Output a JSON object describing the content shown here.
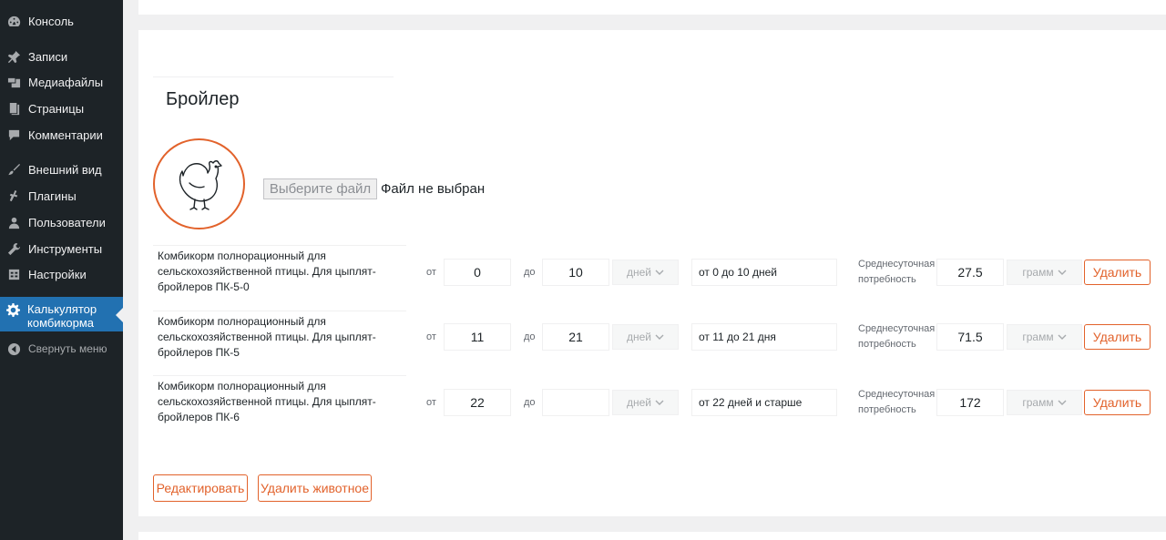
{
  "sidebar": {
    "items": [
      {
        "label": "Консоль",
        "icon": "dashboard-icon"
      },
      {
        "label": "Записи",
        "icon": "pin-icon"
      },
      {
        "label": "Медиафайлы",
        "icon": "media-icon"
      },
      {
        "label": "Страницы",
        "icon": "page-icon"
      },
      {
        "label": "Комментарии",
        "icon": "comment-icon"
      },
      {
        "label": "Внешний вид",
        "icon": "brush-icon"
      },
      {
        "label": "Плагины",
        "icon": "plugin-icon"
      },
      {
        "label": "Пользователи",
        "icon": "user-icon"
      },
      {
        "label": "Инструменты",
        "icon": "wrench-icon"
      },
      {
        "label": "Настройки",
        "icon": "settings-icon"
      }
    ],
    "active": {
      "label": "Калькулятор комбикорма",
      "icon": "gear-icon"
    },
    "collapse": {
      "label": "Свернуть меню",
      "icon": "collapse-icon"
    }
  },
  "animal": {
    "title": "Бройлер",
    "image_icon": "chicken-icon",
    "file_button": "Выберите файл",
    "file_status": "Файл не выбран"
  },
  "labels": {
    "from": "от",
    "to": "до",
    "need": "Среднесуточная потребность",
    "delete": "Удалить"
  },
  "rows": [
    {
      "desc": "Комбикорм полнорационный для сельскохозяйственной птицы. Для цыплят-бройлеров ПК-5-0",
      "from": "0",
      "to": "10",
      "unit": "дней",
      "period": "от 0 до 10 дней",
      "need": "27.5",
      "need_unit": "грамм"
    },
    {
      "desc": "Комбикорм полнорационный для сельскохозяйственной птицы. Для цыплят-бройлеров ПК-5",
      "from": "11",
      "to": "21",
      "unit": "дней",
      "period": "от 11 до 21 дня",
      "need": "71.5",
      "need_unit": "грамм"
    },
    {
      "desc": "Комбикорм полнорационный для сельскохозяйственной птицы. Для цыплят-бройлеров ПК-6",
      "from": "22",
      "to": "",
      "unit": "дней",
      "period": "от 22 дней и старше",
      "need": "172",
      "need_unit": "грамм"
    }
  ],
  "actions": {
    "edit": "Редактировать",
    "delete_animal": "Удалить животное"
  },
  "colors": {
    "accent": "#e2622b",
    "sidebar_bg": "#1d2327",
    "active_bg": "#2271b1"
  }
}
